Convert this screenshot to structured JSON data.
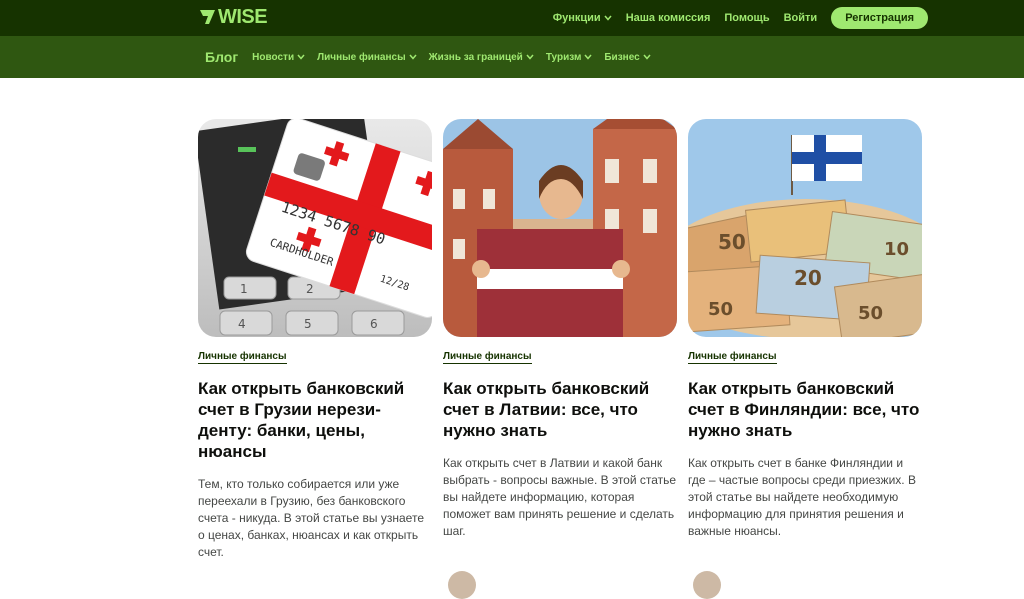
{
  "header": {
    "logo_text": "WISE",
    "nav": [
      {
        "label": "Функции",
        "dropdown": true
      },
      {
        "label": "Наша комиссия",
        "dropdown": false
      },
      {
        "label": "Помощь",
        "dropdown": false
      },
      {
        "label": "Войти",
        "dropdown": false
      }
    ],
    "register_label": "Регистрация"
  },
  "subnav": {
    "brand": "Блог",
    "items": [
      {
        "label": "Новости"
      },
      {
        "label": "Личные финансы"
      },
      {
        "label": "Жизнь за границей"
      },
      {
        "label": "Туризм"
      },
      {
        "label": "Бизнес"
      }
    ]
  },
  "cards": [
    {
      "image_icon": "georgia-card-terminal-image",
      "card_number": "1234 5678 90",
      "card_holder": "CARDHOLDER",
      "card_expiry": "12/28",
      "tag": "Личные финансы",
      "title": "Как открыть банковский счет в Грузии нерези-денту: банки, цены, нюансы",
      "excerpt": "Тем, кто только собирается или уже переехали в Грузию, без банковского счета - никуда. В этой статье вы узнаете о ценах, банках, нюансах и как открыть счет."
    },
    {
      "image_icon": "latvia-flag-woman-image",
      "tag": "Личные финансы",
      "title": "Как открыть банковский счет в Латвии: все, что нужно знать",
      "excerpt": "Как открыть счет в Латвии и какой банк выбрать - вопросы важные. В этой статье вы найдете информацию, которая поможет вам принять решение и сделать шаг."
    },
    {
      "image_icon": "finland-flag-euro-notes-image",
      "tag": "Личные финансы",
      "title": "Как открыть банковский счет в Финляндии: все, что нужно знать",
      "excerpt": "Как открыть счет в банке Финляндии и где – частые вопросы среди приезжих. В этой статье вы найдете необходимую информацию для принятия решения и важные нюансы."
    }
  ],
  "colors": {
    "topbar": "#163300",
    "subbar": "#2f5711",
    "accent": "#9fe870"
  }
}
